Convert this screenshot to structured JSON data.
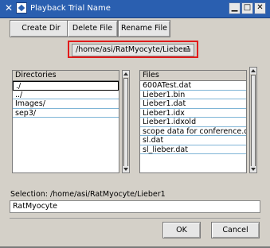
{
  "window": {
    "title": "Playback Trial Name",
    "app_icon": "x-icon",
    "menu_icon": "window-menu-icon",
    "buttons": {
      "minimize": "▁",
      "maximize": "□",
      "close": "✕"
    }
  },
  "toolbar": {
    "create_dir_label": "Create Dir",
    "delete_file_label": "Delete File",
    "rename_file_label": "Rename File"
  },
  "path_dropdown": {
    "value": "/home/asi/RatMyocyte/Lieber1",
    "highlight_color": "#e11b1b"
  },
  "directories": {
    "header": "Directories",
    "items": [
      "./",
      "../",
      "Images/",
      "sep3/"
    ]
  },
  "files": {
    "header": "Files",
    "items": [
      "600ATest.dat",
      "Lieber1.bin",
      "Lieber1.dat",
      "Lieber1.idx",
      "Lieber1.idxold",
      "scope data for conference.dat",
      "sl.dat",
      "sl_lieber.dat"
    ]
  },
  "selection": {
    "label": "Selection: /home/asi/RatMyocyte/Lieber1",
    "input_value": "RatMyocyte"
  },
  "actions": {
    "ok_label": "OK",
    "cancel_label": "Cancel"
  },
  "colors": {
    "titlebar": "#2a5fb0",
    "row_separator": "#7fb5d6"
  }
}
